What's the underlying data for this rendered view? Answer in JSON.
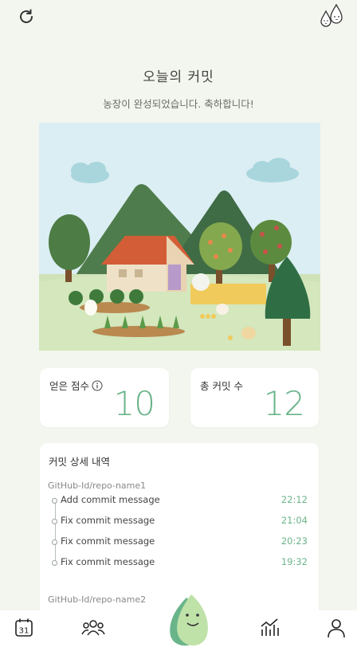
{
  "header": {
    "refresh_icon": "refresh-icon",
    "drops_icon": "water-drops-icon"
  },
  "title": "오늘의 커밋",
  "subtitle": "농장이 완성되었습니다. 축하합니다!",
  "stats": {
    "score_label": "얻은 점수",
    "score_value": "10",
    "commits_label": "총 커밋 수",
    "commits_value": "12"
  },
  "details": {
    "title": "커밋 상세 내역",
    "repos": [
      {
        "name": "GitHub-Id/repo-name1",
        "commits": [
          {
            "message": "Add commit message",
            "time": "22:12"
          },
          {
            "message": "Fix commit message",
            "time": "21:04"
          },
          {
            "message": "Fix commit message",
            "time": "20:23"
          },
          {
            "message": "Fix commit message",
            "time": "19:32"
          }
        ]
      },
      {
        "name": "GitHub-Id/repo-name2",
        "commits": []
      }
    ]
  },
  "nav": {
    "calendar_day": "31",
    "items": [
      "calendar-icon",
      "friends-icon",
      "home-mascot",
      "chart-icon",
      "profile-icon"
    ]
  },
  "colors": {
    "accent": "#6ab48a",
    "background": "#f3f6ee"
  }
}
